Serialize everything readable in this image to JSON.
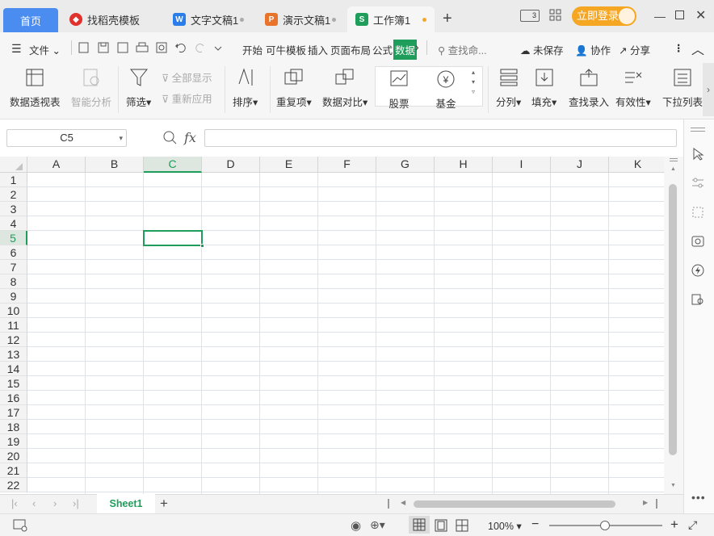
{
  "tabs": {
    "home": "首页",
    "t1": "找稻壳模板",
    "t2": "文字文稿1",
    "t3": "演示文稿1",
    "t4": "工作簿1",
    "login": "立即登录",
    "badge": "3"
  },
  "menu": {
    "file": "文件",
    "items": [
      "开始",
      "可牛模板",
      "插入",
      "页面布局",
      "公式",
      "数据"
    ],
    "search": "查找命...",
    "unsaved": "未保存",
    "collab": "协作",
    "share": "分享"
  },
  "ribbon": {
    "pivot": "数据透视表",
    "smart": "智能分析",
    "filter": "筛选",
    "show_all": "全部显示",
    "reapply": "重新应用",
    "sort": "排序",
    "dup": "重复项",
    "compare": "数据对比",
    "stock": "股票",
    "fund": "基金",
    "split": "分列",
    "fill": "填充",
    "lookup": "查找录入",
    "valid": "有效性",
    "dropdown": "下拉列表"
  },
  "formula": {
    "namebox": "C5",
    "fx": "fx",
    "value": ""
  },
  "grid": {
    "columns": [
      "A",
      "B",
      "C",
      "D",
      "E",
      "F",
      "G",
      "H",
      "I",
      "J",
      "K"
    ],
    "rows": [
      "1",
      "2",
      "3",
      "4",
      "5",
      "6",
      "7",
      "8",
      "9",
      "10",
      "11",
      "12",
      "13",
      "14",
      "15",
      "16",
      "17",
      "18",
      "19",
      "20",
      "21",
      "22"
    ],
    "active_col": "C",
    "active_row": "5"
  },
  "sheets": {
    "active": "Sheet1"
  },
  "status": {
    "zoom": "100%"
  },
  "colors": {
    "accent": "#1e9e5a",
    "home_tab": "#4a8cf0",
    "login": "#f5a623"
  }
}
